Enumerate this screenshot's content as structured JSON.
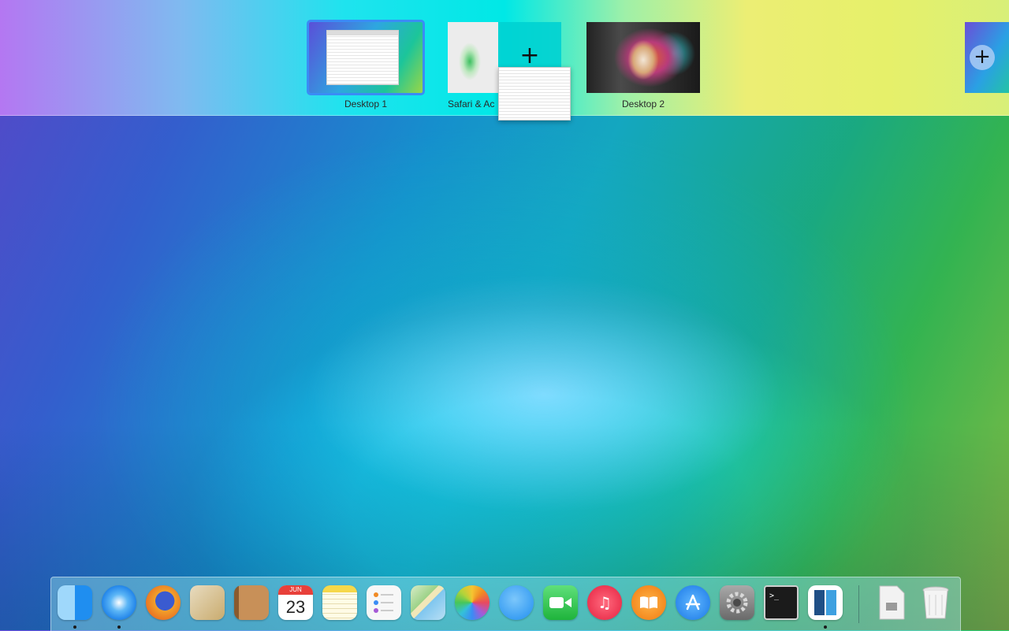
{
  "spaces": {
    "desktop1_label": "Desktop 1",
    "safari_label": "Safari & Ac",
    "desktop2_label": "Desktop 2",
    "add_symbol": "+"
  },
  "dock": {
    "items": [
      {
        "name": "finder",
        "color": "#1f9bf0"
      },
      {
        "name": "safari",
        "color": "#2a8ef0"
      },
      {
        "name": "firefox",
        "color": "#f08a24"
      },
      {
        "name": "mail",
        "color": "#c9ab6e"
      },
      {
        "name": "contacts",
        "color": "#b07a46"
      },
      {
        "name": "calendar",
        "month": "JUN",
        "day": "23"
      },
      {
        "name": "notes",
        "color": "#f6d84a"
      },
      {
        "name": "reminders",
        "color": "#f4f4f4"
      },
      {
        "name": "maps",
        "color": "#7bc46a"
      },
      {
        "name": "photos",
        "color": "#ffffff"
      },
      {
        "name": "messages",
        "color": "#38a3f2"
      },
      {
        "name": "facetime",
        "color": "#27c64a"
      },
      {
        "name": "itunes",
        "color": "#f03454"
      },
      {
        "name": "ibooks",
        "color": "#f08a1c"
      },
      {
        "name": "app-store",
        "color": "#1e8cf0"
      },
      {
        "name": "system-preferences",
        "color": "#8a8a8a"
      },
      {
        "name": "terminal",
        "prompt": ">_"
      },
      {
        "name": "split-view-app",
        "color": "#3a9ad8"
      },
      {
        "name": "downloads-stack",
        "color": "#e8e8e8"
      },
      {
        "name": "trash",
        "color": "#dcdcdc"
      }
    ]
  }
}
